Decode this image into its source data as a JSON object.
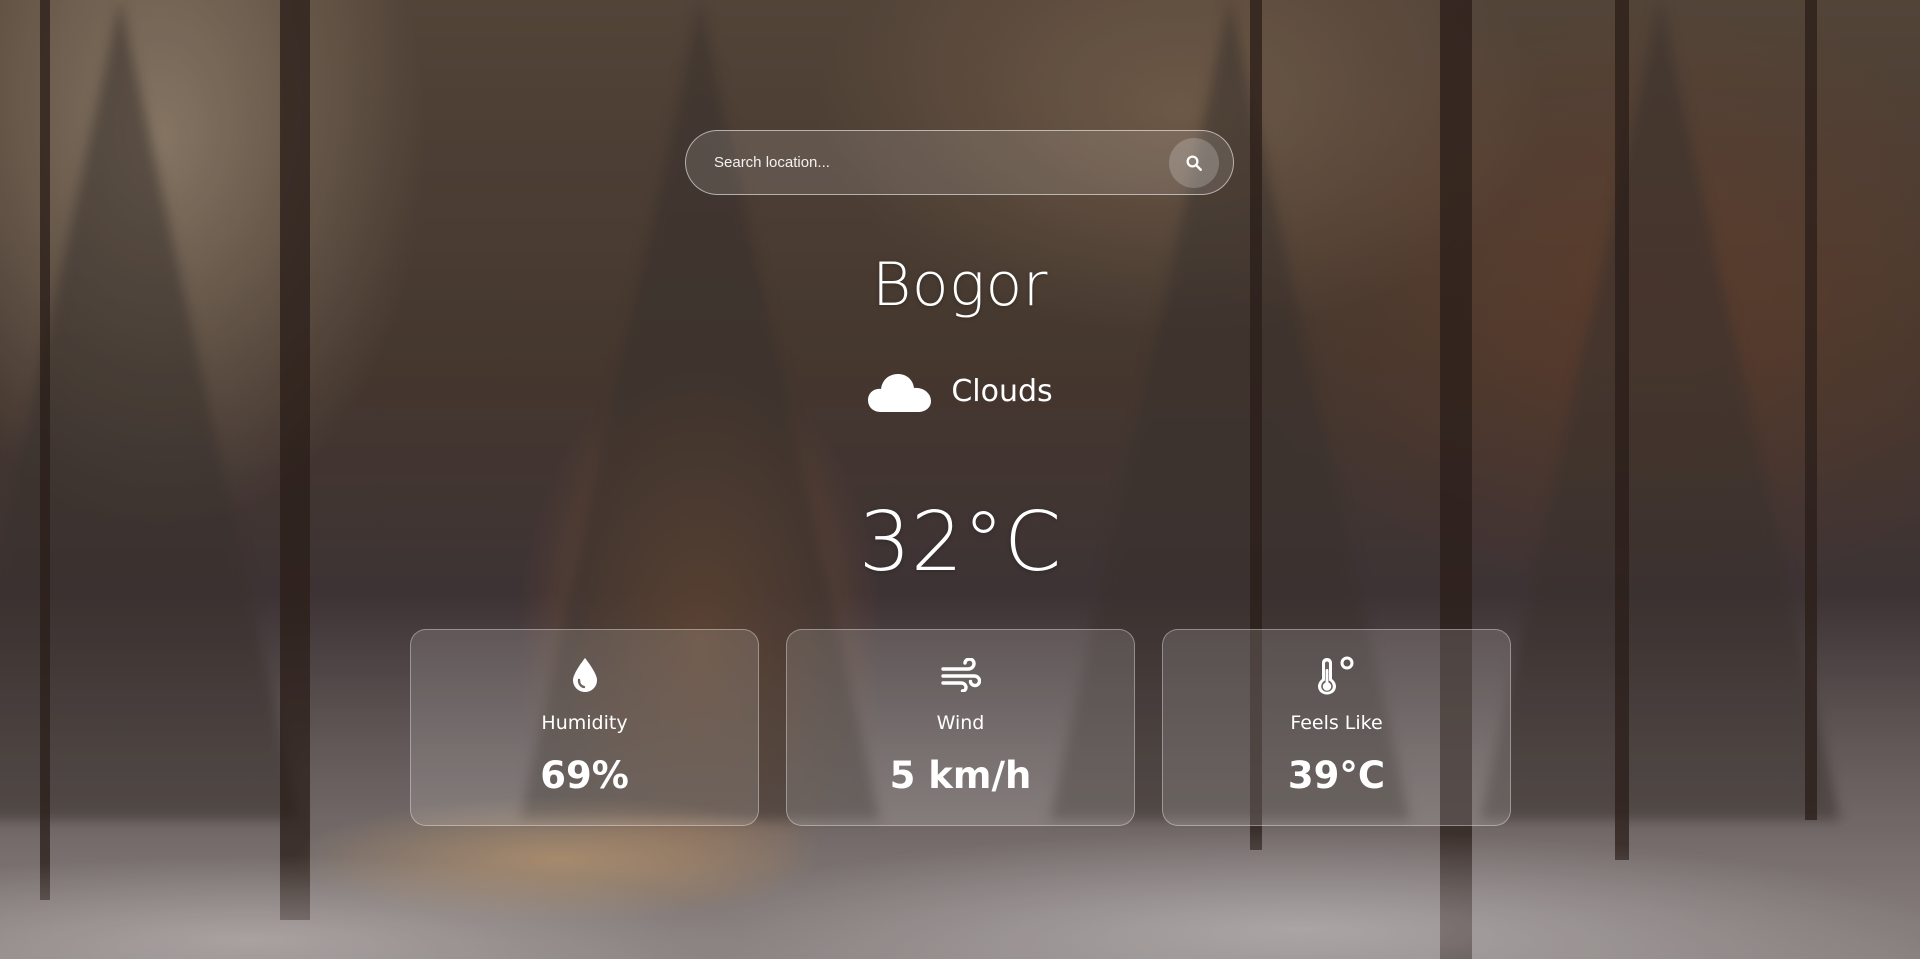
{
  "search": {
    "placeholder": "Search location..."
  },
  "location": {
    "city": "Bogor"
  },
  "weather": {
    "condition": "Clouds",
    "condition_icon": "cloud-icon",
    "temperature": "32°C"
  },
  "stats": [
    {
      "icon": "water-drop-icon",
      "label": "Humidity",
      "value": "69%"
    },
    {
      "icon": "wind-icon",
      "label": "Wind",
      "value": "5 km/h"
    },
    {
      "icon": "thermometer-icon",
      "label": "Feels Like",
      "value": "39°C"
    }
  ],
  "colors": {
    "text": "#ffffff",
    "glass": "rgba(255,255,255,0.14)"
  }
}
